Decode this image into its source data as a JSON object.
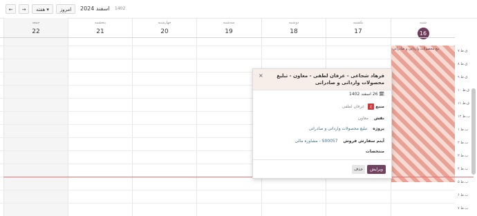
{
  "toolbar": {
    "forward_icon": "arrow-right",
    "back_icon": "arrow-left",
    "view_label": "هفته ▾",
    "today_label": "امروز",
    "title": "اسفند 2024",
    "year": "1402"
  },
  "days": [
    {
      "name": "شنبه",
      "num": "16",
      "today": true
    },
    {
      "name": "یکشنبه",
      "num": "17"
    },
    {
      "name": "دوشنبه",
      "num": "18"
    },
    {
      "name": "سه‌شنبه",
      "num": "19"
    },
    {
      "name": "چهارشنبه",
      "num": "20"
    },
    {
      "name": "پنجشنبه",
      "num": "21"
    },
    {
      "name": "جمعه",
      "num": "22"
    }
  ],
  "hours": [
    "۷ ق.ظ",
    "۸ ق.ظ",
    "۹ ق.ظ",
    "۱۰ ق.ظ",
    "۱۱ ق.ظ",
    "۱۲ ب.ظ",
    "۱ ب.ظ",
    "۲ ب.ظ",
    "۳ ب.ظ",
    "۴ ب.ظ",
    "۵ ب.ظ",
    "۶ ب.ظ",
    "۷ ب.ظ"
  ],
  "event": {
    "text": "تیغ محصولات وارداتی و صادراتی"
  },
  "popover": {
    "title": "فرهاد شجاعی - عرفان لطفی - معاون - تبلیغ محصولات وارداتی و صادراتی",
    "date": "26 اسفند 1402",
    "resource_label": "منبع",
    "resource_value": "عرفان لطفی",
    "role_label": "نقش",
    "role_value": "معاون",
    "project_label": "پروژه",
    "project_value": "تبلیغ محصولات وارداتی و صادراتی",
    "order_label": "آیتم سفارش فروش",
    "order_value": "S00057 - مشاوره مالی",
    "allocated_label": "منتخصات",
    "edit_label": "ویرایش",
    "delete_label": "حذف"
  },
  "colors": {
    "accent": "#71425f",
    "event_stripe": "#e8a192",
    "now_line": "#ee6d6d"
  }
}
